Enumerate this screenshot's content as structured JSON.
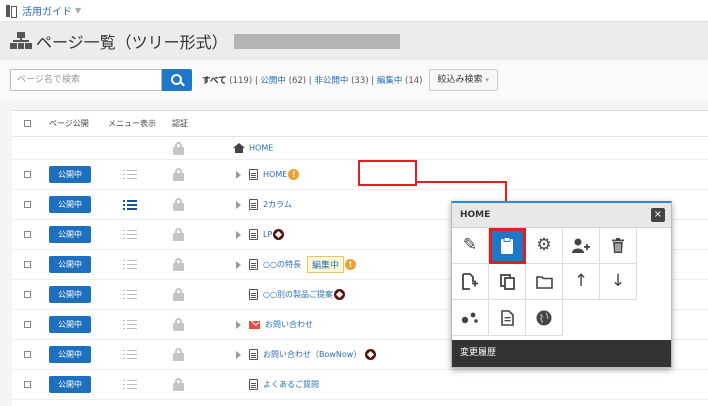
{
  "topbar": {
    "guide_label": "活用ガイド",
    "caret": "▼"
  },
  "page": {
    "title": "ページ一覧（ツリー形式）"
  },
  "search": {
    "placeholder": "ページ名で検索",
    "filters": {
      "all_label": "すべて",
      "all_count": "(119)",
      "published_label": "公開中",
      "published_count": "(62)",
      "unpublished_label": "非公開中",
      "unpublished_count": "(33)",
      "editing_label": "編集中",
      "editing_count": "(14)",
      "sep": "|"
    },
    "narrow_label": "絞込み検索"
  },
  "table": {
    "headers": {
      "publish": "ページ公開",
      "menu": "メニュー表示",
      "auth": "認証"
    },
    "home_label": "HOME",
    "publish_label": "公開中",
    "rows": [
      {
        "label": "HOME",
        "badge": "!"
      },
      {
        "label": "2カラム"
      },
      {
        "label": "LP"
      },
      {
        "label": "○○の特長",
        "editing": "編集中",
        "badge": "!"
      },
      {
        "label": "○○別の製品ご提案"
      },
      {
        "label": "お問い合わせ"
      },
      {
        "label": "お問い合わせ（BowNow）"
      },
      {
        "label": "よくあるご質問"
      }
    ]
  },
  "popup": {
    "title": "HOME",
    "close": "×",
    "footer": "変更履歴",
    "icons": [
      "pencil-icon",
      "clipboard-icon",
      "gear-icon",
      "add-user-icon",
      "trash-icon",
      "new-page-icon",
      "copy-icon",
      "folder-icon",
      "arrow-up-icon",
      "arrow-down-icon",
      "share-icon",
      "document-icon",
      "globe-icon"
    ]
  },
  "colors": {
    "accent": "#1e77c8",
    "highlight": "#e02020",
    "warning": "#f0a030"
  }
}
